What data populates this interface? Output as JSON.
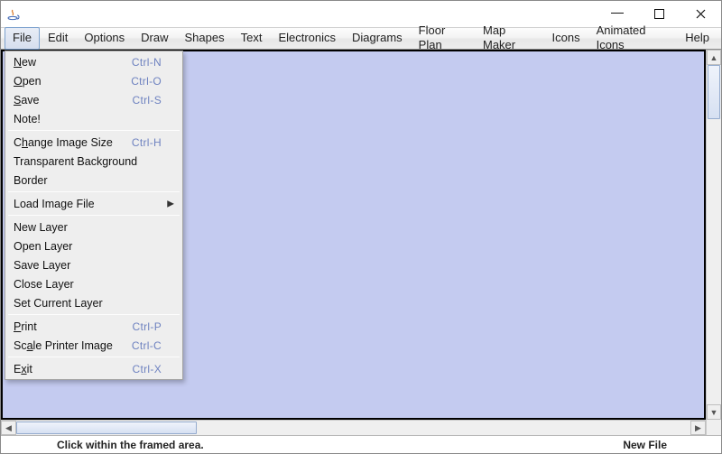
{
  "window": {
    "title": ""
  },
  "menubar": {
    "items": [
      {
        "label": "File",
        "active": true
      },
      {
        "label": "Edit",
        "active": false
      },
      {
        "label": "Options",
        "active": false
      },
      {
        "label": "Draw",
        "active": false
      },
      {
        "label": "Shapes",
        "active": false
      },
      {
        "label": "Text",
        "active": false
      },
      {
        "label": "Electronics",
        "active": false
      },
      {
        "label": "Diagrams",
        "active": false
      },
      {
        "label": "Floor Plan",
        "active": false
      },
      {
        "label": "Map Maker",
        "active": false
      },
      {
        "label": "Icons",
        "active": false
      },
      {
        "label": "Animated Icons",
        "active": false
      },
      {
        "label": "Help",
        "active": false
      }
    ]
  },
  "file_menu": {
    "groups": [
      [
        {
          "label": "New",
          "mnemonic": "N",
          "shortcut": "Ctrl-N",
          "submenu": false
        },
        {
          "label": "Open",
          "mnemonic": "O",
          "shortcut": "Ctrl-O",
          "submenu": false
        },
        {
          "label": "Save",
          "mnemonic": "S",
          "shortcut": "Ctrl-S",
          "submenu": false
        },
        {
          "label": "Note!",
          "mnemonic": "",
          "shortcut": "",
          "submenu": false
        }
      ],
      [
        {
          "label": "Change Image Size",
          "mnemonic": "h",
          "shortcut": "Ctrl-H",
          "submenu": false
        },
        {
          "label": "Transparent Background",
          "mnemonic": "",
          "shortcut": "",
          "submenu": false
        },
        {
          "label": "Border",
          "mnemonic": "",
          "shortcut": "",
          "submenu": false
        }
      ],
      [
        {
          "label": "Load Image File",
          "mnemonic": "",
          "shortcut": "",
          "submenu": true
        }
      ],
      [
        {
          "label": "New Layer",
          "mnemonic": "",
          "shortcut": "",
          "submenu": false
        },
        {
          "label": "Open Layer",
          "mnemonic": "",
          "shortcut": "",
          "submenu": false
        },
        {
          "label": "Save Layer",
          "mnemonic": "",
          "shortcut": "",
          "submenu": false
        },
        {
          "label": "Close Layer",
          "mnemonic": "",
          "shortcut": "",
          "submenu": false
        },
        {
          "label": "Set Current Layer",
          "mnemonic": "",
          "shortcut": "",
          "submenu": false
        }
      ],
      [
        {
          "label": "Print",
          "mnemonic": "P",
          "shortcut": "Ctrl-P",
          "submenu": false
        },
        {
          "label": "Scale Printer Image",
          "mnemonic": "a",
          "shortcut": "Ctrl-C",
          "submenu": false
        }
      ],
      [
        {
          "label": "Exit",
          "mnemonic": "x",
          "shortcut": "Ctrl-X",
          "submenu": false
        }
      ]
    ]
  },
  "canvas": {
    "background_color": "#c4cbf0"
  },
  "statusbar": {
    "left": "Click within the framed area.",
    "right": "New File"
  },
  "titlebar_controls": {
    "minimize": "—",
    "maximize": "□",
    "close": "✕"
  },
  "scroll_arrows": {
    "up": "▲",
    "down": "▼",
    "left": "◀",
    "right": "▶"
  }
}
